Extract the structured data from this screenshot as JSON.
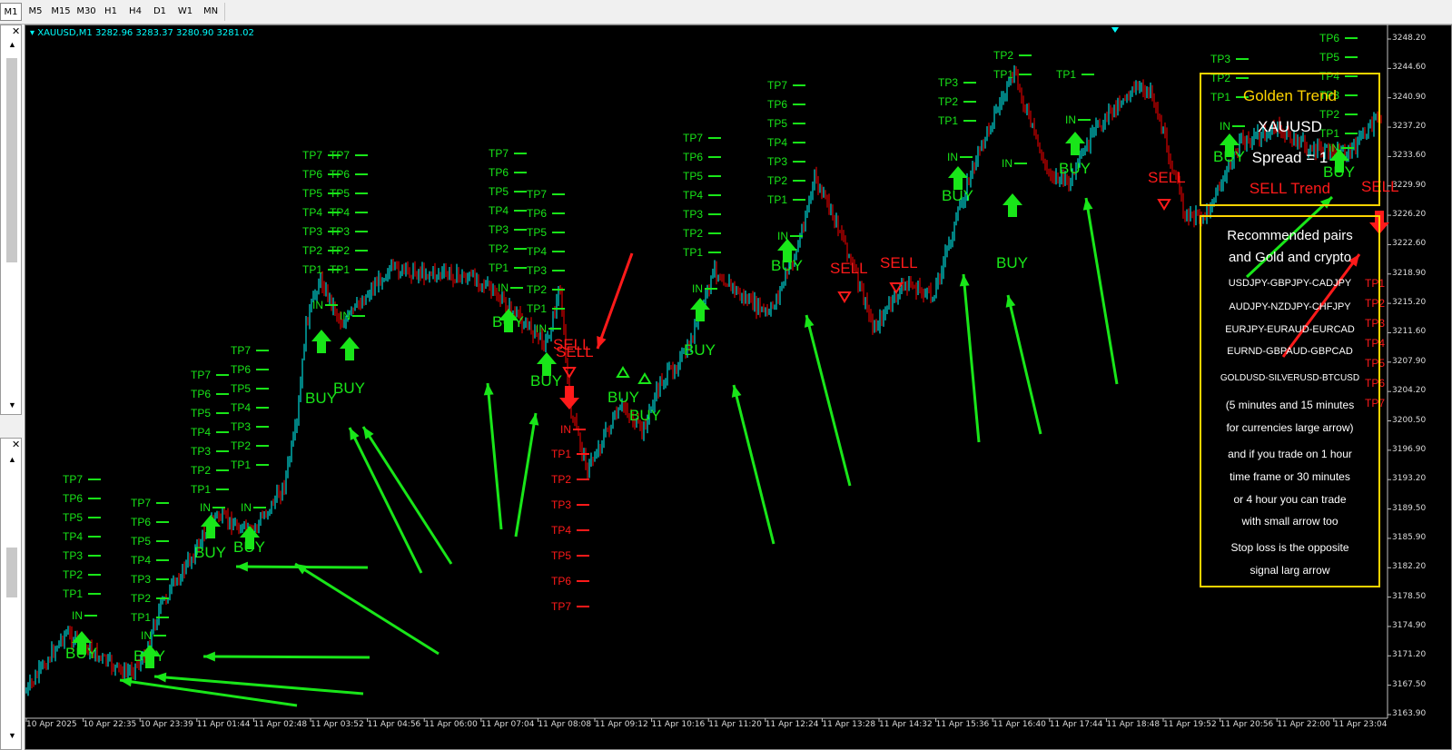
{
  "toolbar": {
    "timeframes": [
      "M1",
      "M5",
      "M15",
      "M30",
      "H1",
      "H4",
      "D1",
      "W1",
      "MN"
    ]
  },
  "chart": {
    "symbol_line": "XAUUSD,M1  3282.96 3283.37 3280.90 3281.02",
    "price_ticks": [
      "3248.20",
      "3244.60",
      "3240.90",
      "3237.20",
      "3233.60",
      "3229.90",
      "3226.20",
      "3222.60",
      "3218.90",
      "3215.20",
      "3211.60",
      "3207.90",
      "3204.20",
      "3200.50",
      "3196.90",
      "3193.20",
      "3189.50",
      "3185.90",
      "3182.20",
      "3178.50",
      "3174.90",
      "3171.20",
      "3167.50",
      "3163.90"
    ],
    "time_ticks": [
      "10 Apr 2025",
      "10 Apr 22:35",
      "10 Apr 23:39",
      "11 Apr 01:44",
      "11 Apr 02:48",
      "11 Apr 03:52",
      "11 Apr 04:56",
      "11 Apr 06:00",
      "11 Apr 07:04",
      "11 Apr 08:08",
      "11 Apr 09:12",
      "11 Apr 10:16",
      "11 Apr 11:20",
      "11 Apr 12:24",
      "11 Apr 13:28",
      "11 Apr 14:32",
      "11 Apr 15:36",
      "11 Apr 16:40",
      "11 Apr 17:44",
      "11 Apr 18:48",
      "11 Apr 19:52",
      "11 Apr 20:56",
      "11 Apr 22:00",
      "11 Apr 23:04"
    ],
    "colors": {
      "background": "#000000",
      "bull": "#00ffff",
      "bear": "#ff0000",
      "signal_green": "#19e619",
      "signal_red": "#ff1a1a",
      "panel_border": "#ffd400"
    },
    "signal_labels": {
      "buy": "BUY",
      "sell": "SELL",
      "entry": "IN",
      "tp": [
        "TP1",
        "TP2",
        "TP3",
        "TP4",
        "TP5",
        "TP6",
        "TP7"
      ]
    }
  },
  "golden_panel": {
    "title": "Golden Trend",
    "symbol": "XAUUSD",
    "spread": "Spread = 1",
    "trend": "SELL Trend"
  },
  "info_panel": {
    "heading1": "Recommended pairs",
    "heading2": "and Gold and crypto",
    "pairs1": "USDJPY-GBPJPY-CADJPY",
    "pairs2": "AUDJPY-NZDJPY-CHFJPY",
    "pairs3": "EURJPY-EURAUD-EURCAD",
    "pairs4": "EURND-GBPAUD-GBPCAD",
    "pairs5": "GOLDUSD-SILVERUSD-BTCUSD",
    "note1": "(5 minutes and 15 minutes",
    "note2": "for currencies large arrow)",
    "note3": "and if you trade on 1 hour",
    "note4": "time frame or 30 minutes",
    "note5": "or 4 hour you can trade",
    "note6": "with small arrow too",
    "note7": "Stop loss is the opposite",
    "note8": "signal larg arrow"
  }
}
